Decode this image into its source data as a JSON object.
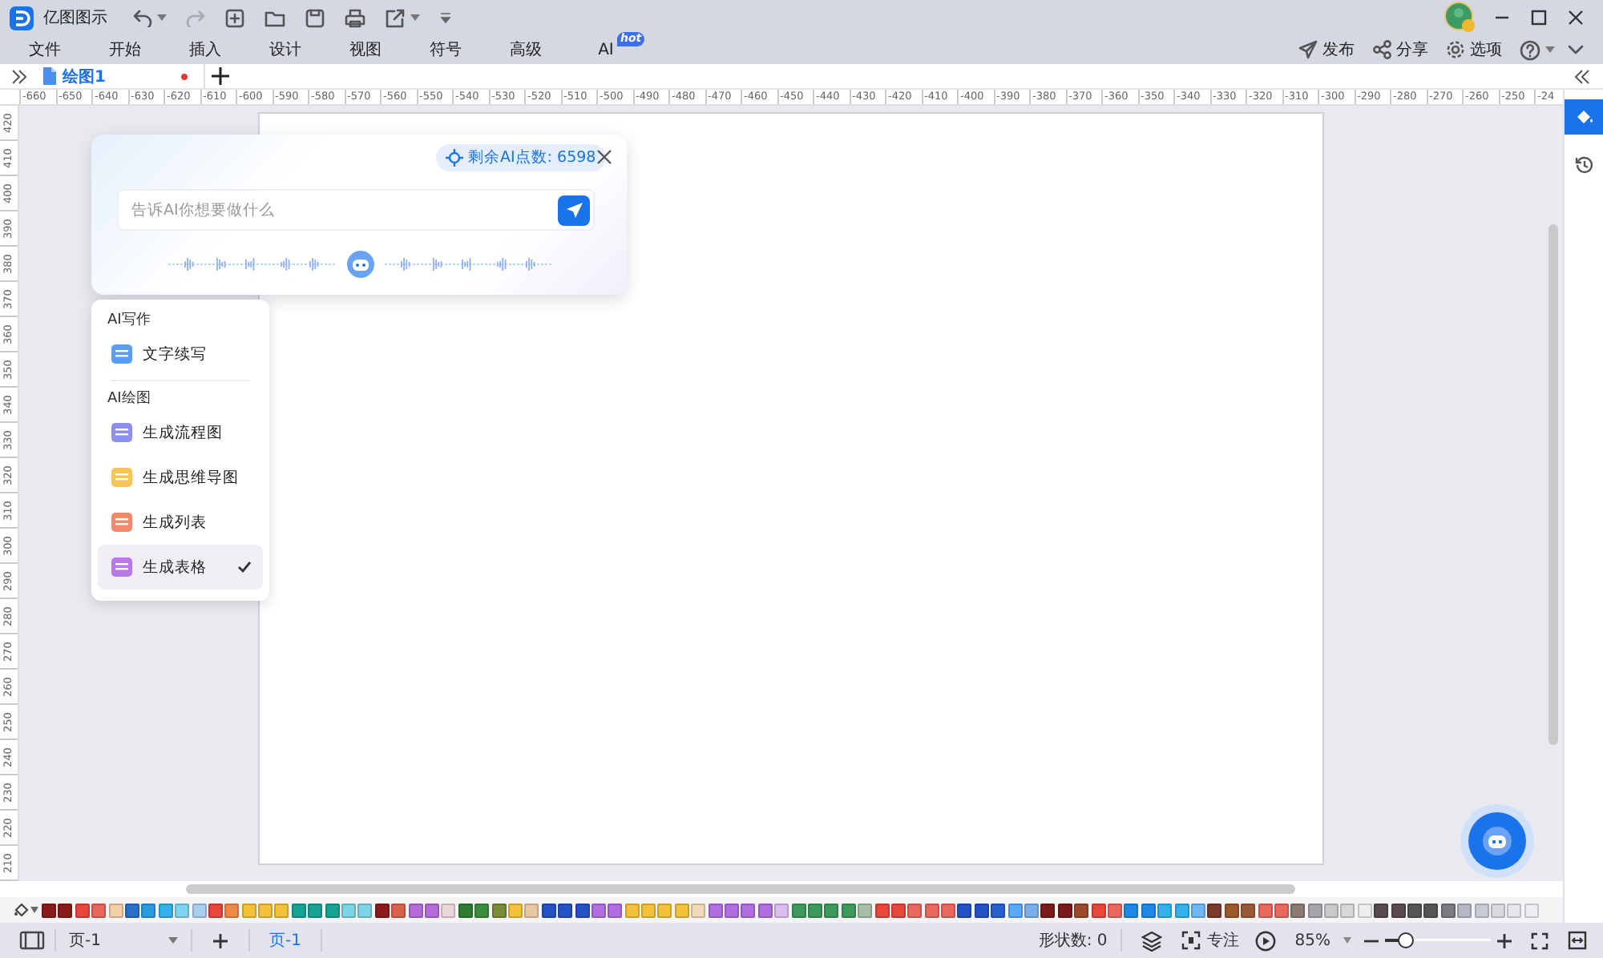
{
  "title_bar": {
    "app_name": "亿图图示"
  },
  "menu_bar": {
    "items": [
      {
        "label": "文件"
      },
      {
        "label": "开始"
      },
      {
        "label": "插入"
      },
      {
        "label": "设计"
      },
      {
        "label": "视图"
      },
      {
        "label": "符号"
      },
      {
        "label": "高级"
      },
      {
        "label": "AI",
        "badge": "hot"
      }
    ],
    "actions": [
      {
        "kind": "publish",
        "label": "发布"
      },
      {
        "kind": "share",
        "label": "分享"
      },
      {
        "kind": "options",
        "label": "选项"
      }
    ]
  },
  "document_tabs": [
    {
      "label": "绘图1",
      "selected": true,
      "unsaved": true
    }
  ],
  "ruler_top": {
    "labels": [
      "-660",
      "-650",
      "-640",
      "-630",
      "-620",
      "-610",
      "-600",
      "-590",
      "-580",
      "-570",
      "-560",
      "-550",
      "-540",
      "-530",
      "-520",
      "-510",
      "-500",
      "-490",
      "-480",
      "-470",
      "-460",
      "-450",
      "-440",
      "-430",
      "-420",
      "-410",
      "-400",
      "-390",
      "-380",
      "-370",
      "-360",
      "-350",
      "-340",
      "-330",
      "-320",
      "-310",
      "-300",
      "-290",
      "-280",
      "-270",
      "-260",
      "-250",
      "-24"
    ]
  },
  "ruler_left": {
    "labels": [
      "420",
      "410",
      "400",
      "390",
      "380",
      "370",
      "360",
      "350",
      "340",
      "330",
      "320",
      "310",
      "300",
      "290",
      "280",
      "270",
      "260",
      "250",
      "240",
      "230",
      "220",
      "210"
    ]
  },
  "ai_panel": {
    "credits": "剩余AI点数: 6598",
    "input": {
      "placeholder": "告诉AI你想要做什么"
    }
  },
  "ai_menu": {
    "sections": [
      {
        "title": "AI写作",
        "items": [
          {
            "label": "文字续写",
            "color": "#5b9cf6",
            "selected": false
          }
        ]
      },
      {
        "title": "AI绘图",
        "items": [
          {
            "label": "生成流程图",
            "color": "#8d8ff0",
            "selected": false
          },
          {
            "label": "生成思维导图",
            "color": "#f5c451",
            "selected": false
          },
          {
            "label": "生成列表",
            "color": "#f08a6a",
            "selected": false
          },
          {
            "label": "生成表格",
            "color": "#b978e8",
            "selected": true
          }
        ]
      }
    ]
  },
  "side_panel": {
    "tools": [
      {
        "kind": "style",
        "selected": true
      },
      {
        "kind": "history",
        "selected": false
      }
    ]
  },
  "palette": {
    "colors": [
      {
        "color": "#8b1a1a"
      },
      {
        "color": "#8b1a1a"
      },
      {
        "color": "#e8473b"
      },
      {
        "color": "#e9665d"
      },
      {
        "color": "#f2cfa4"
      },
      {
        "color": "#2a6fc9"
      },
      {
        "color": "#2a9de0"
      },
      {
        "color": "#33b1ea"
      },
      {
        "color": "#7fd3ee"
      },
      {
        "color": "#a9cff0"
      },
      {
        "color": "#e8473b"
      },
      {
        "color": "#ec8a4a"
      },
      {
        "color": "#f4c13a"
      },
      {
        "color": "#f4c13a"
      },
      {
        "color": "#f4c13a"
      },
      {
        "color": "#17a394"
      },
      {
        "color": "#17a394"
      },
      {
        "color": "#17a394"
      },
      {
        "color": "#7fd3e6"
      },
      {
        "color": "#7fd3e6"
      },
      {
        "color": "#8b1a1a"
      },
      {
        "color": "#d9624f"
      },
      {
        "color": "#b56bd9"
      },
      {
        "color": "#b56bd9"
      },
      {
        "color": "#ecd6d8"
      },
      {
        "color": "#2e7d32"
      },
      {
        "color": "#3d8b3d"
      },
      {
        "color": "#7a8b3a"
      },
      {
        "color": "#f4c13a"
      },
      {
        "color": "#eac7a3"
      },
      {
        "color": "#2451c4"
      },
      {
        "color": "#2451c4"
      },
      {
        "color": "#2451c4"
      },
      {
        "color": "#b16ee0"
      },
      {
        "color": "#b16ee0"
      },
      {
        "color": "#f4c13a"
      },
      {
        "color": "#f4c13a"
      },
      {
        "color": "#f4c13a"
      },
      {
        "color": "#f4c13a"
      },
      {
        "color": "#f2d9b8"
      },
      {
        "color": "#b16ee0"
      },
      {
        "color": "#b16ee0"
      },
      {
        "color": "#b16ee0"
      },
      {
        "color": "#b16ee0"
      },
      {
        "color": "#dcbdf2"
      },
      {
        "color": "#3d9a5c"
      },
      {
        "color": "#3d9a5c"
      },
      {
        "color": "#3d9a5c"
      },
      {
        "color": "#3d9a5c"
      },
      {
        "color": "#a8bfa6"
      },
      {
        "color": "#e8473b"
      },
      {
        "color": "#e8473b"
      },
      {
        "color": "#e9695f"
      },
      {
        "color": "#e9695f"
      },
      {
        "color": "#e9695f"
      },
      {
        "color": "#2451c4"
      },
      {
        "color": "#2451c4"
      },
      {
        "color": "#2a5fd0"
      },
      {
        "color": "#5aaaf5"
      },
      {
        "color": "#7ab0ea"
      },
      {
        "color": "#7a1a1a"
      },
      {
        "color": "#7a1a1a"
      },
      {
        "color": "#9a4a2a"
      },
      {
        "color": "#e8473b"
      },
      {
        "color": "#e9695f"
      },
      {
        "color": "#1e88e5"
      },
      {
        "color": "#1e88e5"
      },
      {
        "color": "#33b1ea"
      },
      {
        "color": "#33b1ea"
      },
      {
        "color": "#6fb8f5"
      },
      {
        "color": "#7a3a2a"
      },
      {
        "color": "#9a5a2a"
      },
      {
        "color": "#9a5a3a"
      },
      {
        "color": "#e9695f"
      },
      {
        "color": "#e9695f"
      },
      {
        "color": "#8a7a72"
      },
      {
        "color": "#a4a6aa"
      },
      {
        "color": "#c8c9cb"
      },
      {
        "color": "#d6d7d9"
      },
      {
        "color": "#eeeef0"
      },
      {
        "color": "#5a4a4e"
      },
      {
        "color": "#5a4a4e"
      },
      {
        "color": "#555558"
      },
      {
        "color": "#555558"
      },
      {
        "color": "#7a7c80"
      },
      {
        "color": "#b4b7c4"
      },
      {
        "color": "#c9cbd2"
      },
      {
        "color": "#d8dae0"
      },
      {
        "color": "#e4e6ea"
      },
      {
        "color": "#eceef2"
      }
    ]
  },
  "status_bar": {
    "page_dropdown": "页-1",
    "page_tabs": [
      {
        "label": "页-1",
        "selected": true
      }
    ],
    "shape_count": "形状数: 0",
    "focus": "专注",
    "zoom": "85%",
    "zoom_slider": {
      "level": 0.2
    }
  }
}
